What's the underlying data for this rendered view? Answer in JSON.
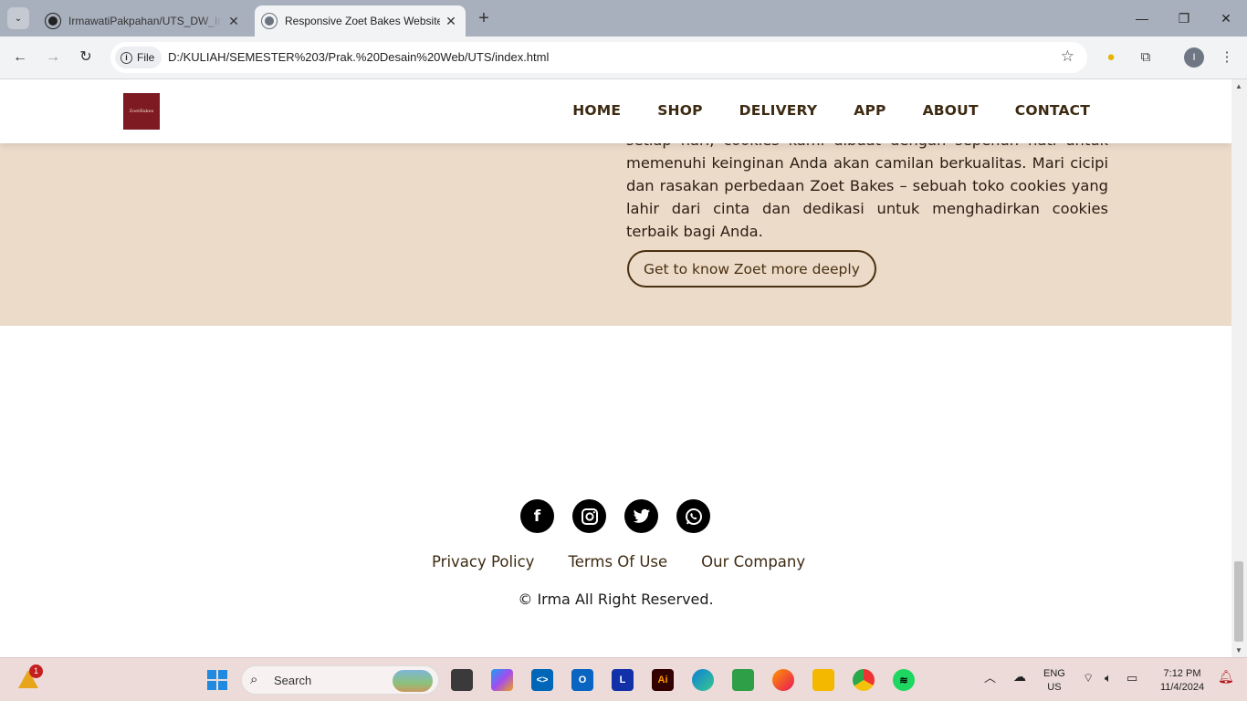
{
  "browser": {
    "tabs": [
      {
        "title": "IrmawatiPakpahan/UTS_DW_Irma",
        "active": false
      },
      {
        "title": "Responsive Zoet Bakes Website",
        "active": true
      }
    ],
    "address_chip": "File",
    "url": "D:/KULIAH/SEMESTER%203/Prak.%20Desain%20Web/UTS/index.html",
    "profile_initial": "I"
  },
  "site": {
    "logo_text": "ZoetBakes",
    "nav": [
      "HOME",
      "SHOP",
      "DELIVERY",
      "APP",
      "ABOUT",
      "CONTACT"
    ],
    "about": {
      "text": "setiap hari, cookies kami dibuat dengan sepenuh hati untuk memenuhi keinginan Anda akan camilan berkualitas. Mari cicipi dan rasakan perbedaan Zoet Bakes – sebuah toko cookies yang lahir dari cinta dan dedikasi untuk menghadirkan cookies terbaik bagi Anda.",
      "button": "Get to know Zoet more deeply"
    },
    "footer": {
      "socials": [
        "facebook-icon",
        "instagram-icon",
        "twitter-icon",
        "whatsapp-icon"
      ],
      "links": [
        "Privacy Policy",
        "Terms Of Use",
        "Our Company"
      ],
      "copyright": "© Irma All Right Reserved."
    }
  },
  "taskbar": {
    "weather_badge": "1",
    "search_placeholder": "Search",
    "language": "ENG",
    "region": "US",
    "time": "7:12 PM",
    "date": "11/4/2024"
  },
  "colors": {
    "about_bg": "#ecdbc9",
    "brand_brown": "#3d2a12",
    "logo_bg": "#7d1a22"
  }
}
